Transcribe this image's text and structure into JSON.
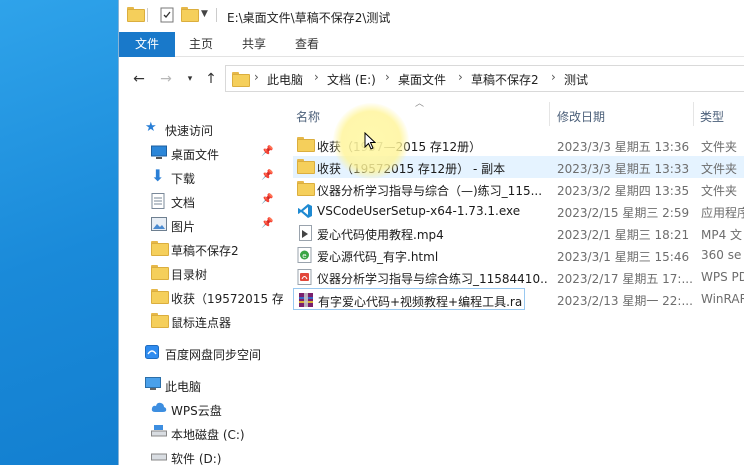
{
  "title_path": "E:\\桌面文件\\草稿不保存2\\测试",
  "ribbon": {
    "tabs": [
      "文件",
      "主页",
      "共享",
      "查看"
    ]
  },
  "breadcrumb": [
    "此电脑",
    "文档 (E:)",
    "桌面文件",
    "草稿不保存2",
    "测试"
  ],
  "nav": {
    "quick_access": "快速访问",
    "items": [
      "桌面文件",
      "下载",
      "文档",
      "图片",
      "草稿不保存2",
      "目录树",
      "收获（19572015 存",
      "鼠标连点器"
    ],
    "baidu": "百度网盘同步空间",
    "this_pc": "此电脑",
    "drives": [
      "WPS云盘",
      "本地磁盘 (C:)",
      "软件 (D:)"
    ]
  },
  "columns": {
    "name": "名称",
    "date": "修改日期",
    "type": "类型"
  },
  "files": [
    {
      "name": "收获（1957—2015  存12册）",
      "date": "2023/3/3 星期五 13:36",
      "type": "文件夹",
      "icon": "folder-icon"
    },
    {
      "name": "收获（19572015  存12册） - 副本",
      "date": "2023/3/3 星期五 13:33",
      "type": "文件夹",
      "icon": "folder-icon"
    },
    {
      "name": "仪器分析学习指导与综合（—)练习_115...",
      "date": "2023/3/2 星期四 13:35",
      "type": "文件夹",
      "icon": "folder-icon"
    },
    {
      "name": "VSCodeUserSetup-x64-1.73.1.exe",
      "date": "2023/2/15 星期三 2:59",
      "type": "应用程序",
      "icon": "vscode-icon"
    },
    {
      "name": "爱心代码使用教程.mp4",
      "date": "2023/2/1 星期三 18:21",
      "type": "MP4 文",
      "icon": "video-file-icon"
    },
    {
      "name": "爱心源代码_有字.html",
      "date": "2023/3/1 星期三 15:46",
      "type": "360 se H",
      "icon": "html-file-icon"
    },
    {
      "name": "仪器分析学习指导与综合练习_11584410...",
      "date": "2023/2/17 星期五 17:...",
      "type": "WPS PD",
      "icon": "pdf-file-icon"
    },
    {
      "name": "有字爱心代码+视频教程+编程工具.rar",
      "date": "2023/2/13 星期一 22:...",
      "type": "WinRAR",
      "icon": "rar-file-icon"
    }
  ],
  "colors": {
    "ribbon_file_tab": "#1979ca",
    "selection": "#e5f3ff",
    "desktop": "#1d8fe0"
  }
}
